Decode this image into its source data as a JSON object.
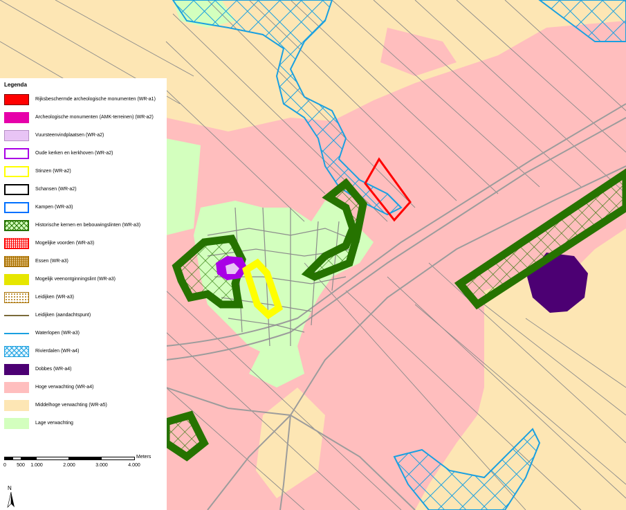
{
  "legend": {
    "title": "Legenda",
    "items": [
      {
        "label": "Rijksbeschermde archeologische monumenten (WR-a1)",
        "swatch": "red-fill",
        "color": "#ff0000"
      },
      {
        "label": "Archeologische monumenten (AMK-terreinen) (WR-a2)",
        "swatch": "magenta-fill",
        "color": "#e600a9"
      },
      {
        "label": "Vuursteenvindplaatsen (WR-a2)",
        "swatch": "lilac-fill",
        "color": "#e8c4f5"
      },
      {
        "label": "Oude kerken en kerkhoven (WR-a2)",
        "swatch": "purple-outline",
        "color": "#a900e6"
      },
      {
        "label": "Stinzen (WR-a2)",
        "swatch": "yellow-outline",
        "color": "#ffff00"
      },
      {
        "label": "Schansen (WR-a2)",
        "swatch": "black-outline",
        "color": "#000000"
      },
      {
        "label": "Kampen (WR-a3)",
        "swatch": "blue-outline",
        "color": "#0070ff"
      },
      {
        "label": "Historische kernen en bebouwingslinten (WR-a3)",
        "swatch": "green-hatch",
        "color": "#267300"
      },
      {
        "label": "Mogelijke voorden (WR-a3)",
        "swatch": "red-grid",
        "color": "#ff0000"
      },
      {
        "label": "Essen (WR-a3)",
        "swatch": "brown-grid",
        "color": "#a87000"
      },
      {
        "label": "Mogelijk veenontginningslint (WR-a3)",
        "swatch": "yellow-fill",
        "color": "#e6e600"
      },
      {
        "label": "Leidijken (WR-a3)",
        "swatch": "brown-dots",
        "color": "#a87000"
      },
      {
        "label": "Leidijken (aandachtspunt)",
        "swatch": "brown-line",
        "color": "#7a6a3a"
      },
      {
        "label": "Waterlopen (WR-a3)",
        "swatch": "blue-line",
        "color": "#1aa0e0"
      },
      {
        "label": "Rivierdalen (WR-a4)",
        "swatch": "cyan-hatch",
        "color": "#00a9e6"
      },
      {
        "label": "Dobbes (WR-a4)",
        "swatch": "darkpurple-fill",
        "color": "#4c0073"
      },
      {
        "label": "Hoge verwachting (WR-a4)",
        "swatch": "pink-fill",
        "color": "#ffbebe"
      },
      {
        "label": "Middelhoge verwachting (WR-a5)",
        "swatch": "cream-fill",
        "color": "#fde6b4"
      },
      {
        "label": "Lage verwachting",
        "swatch": "lightgreen-fill",
        "color": "#d3ffbe"
      }
    ]
  },
  "scalebar": {
    "unit": "Meters",
    "ticks": [
      "0",
      "500",
      "1.000",
      "2.000",
      "3.000",
      "4.000"
    ]
  },
  "north_arrow": {
    "label": "N"
  }
}
